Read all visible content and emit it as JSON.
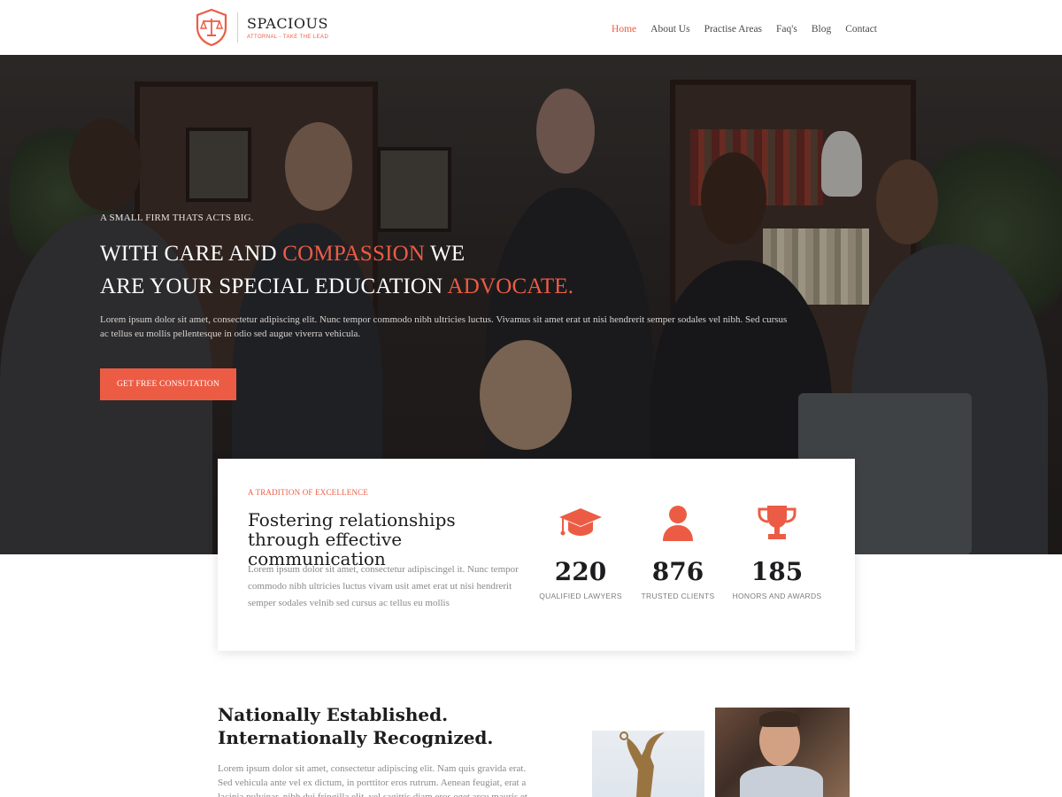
{
  "colors": {
    "accent": "#ec5c45",
    "hero_bg": "#2c2726",
    "text_dark": "#1d1d1f",
    "text_muted": "#8a8a8a"
  },
  "header": {
    "logo": {
      "icon": "scales-shield-icon",
      "title": "SPACIOUS",
      "tagline": "ATTORNAL - TAKE THE LEAD"
    },
    "nav": [
      {
        "label": "Home",
        "active": true
      },
      {
        "label": "About Us",
        "active": false
      },
      {
        "label": "Practise Areas",
        "active": false
      },
      {
        "label": "Faq's",
        "active": false
      },
      {
        "label": "Blog",
        "active": false
      },
      {
        "label": "Contact",
        "active": false
      }
    ]
  },
  "hero": {
    "kicker": "A SMALL FIRM THATS ACTS BIG.",
    "title_part1": "WITH CARE AND ",
    "title_accent1": "COMPASSION",
    "title_part2": " WE",
    "title_part3": "ARE YOUR SPECIAL EDUCATION ",
    "title_accent2": "ADVOCATE.",
    "description": "Lorem ipsum dolor sit amet, consectetur adipiscing elit. Nunc tempor commodo nibh ultricies luctus. Vivamus sit amet erat ut nisi hendrerit semper sodales vel nibh. Sed cursus ac tellus eu mollis pellentesque in odio sed augue viverra vehicula.",
    "cta_label": "GET FREE CONSUTATION"
  },
  "stats_card": {
    "kicker": "A TRADITION OF EXCELLENCE",
    "title": "Fostering relationships through effective communication",
    "description": "Lorem ipsum dolor sit amet, consectetur adipiscingel it. Nunc tempor commodo nibh ultricies luctus vivam usit amet erat ut nisi hendrerit semper sodales velnib sed cursus ac tellus eu mollis",
    "stats": [
      {
        "icon": "graduation-cap-icon",
        "value": "220",
        "label": "QUALIFIED LAWYERS"
      },
      {
        "icon": "user-icon",
        "value": "876",
        "label": "TRUSTED CLIENTS"
      },
      {
        "icon": "trophy-icon",
        "value": "185",
        "label": "HONORS AND AWARDS"
      }
    ]
  },
  "about": {
    "title_line1": "Nationally Established.",
    "title_line2": "Internationally Recognized.",
    "description": "Lorem ipsum dolor sit amet, consectetur adipiscing elit. Nam quis gravida erat. Sed vehicula ante vel ex dictum, in porttitor eros rutrum. Aenean feugiat, erat a lacinia pulvinar, nibh dui fringilla elit, vel sagittis diam eros eget arcu mauris et"
  }
}
